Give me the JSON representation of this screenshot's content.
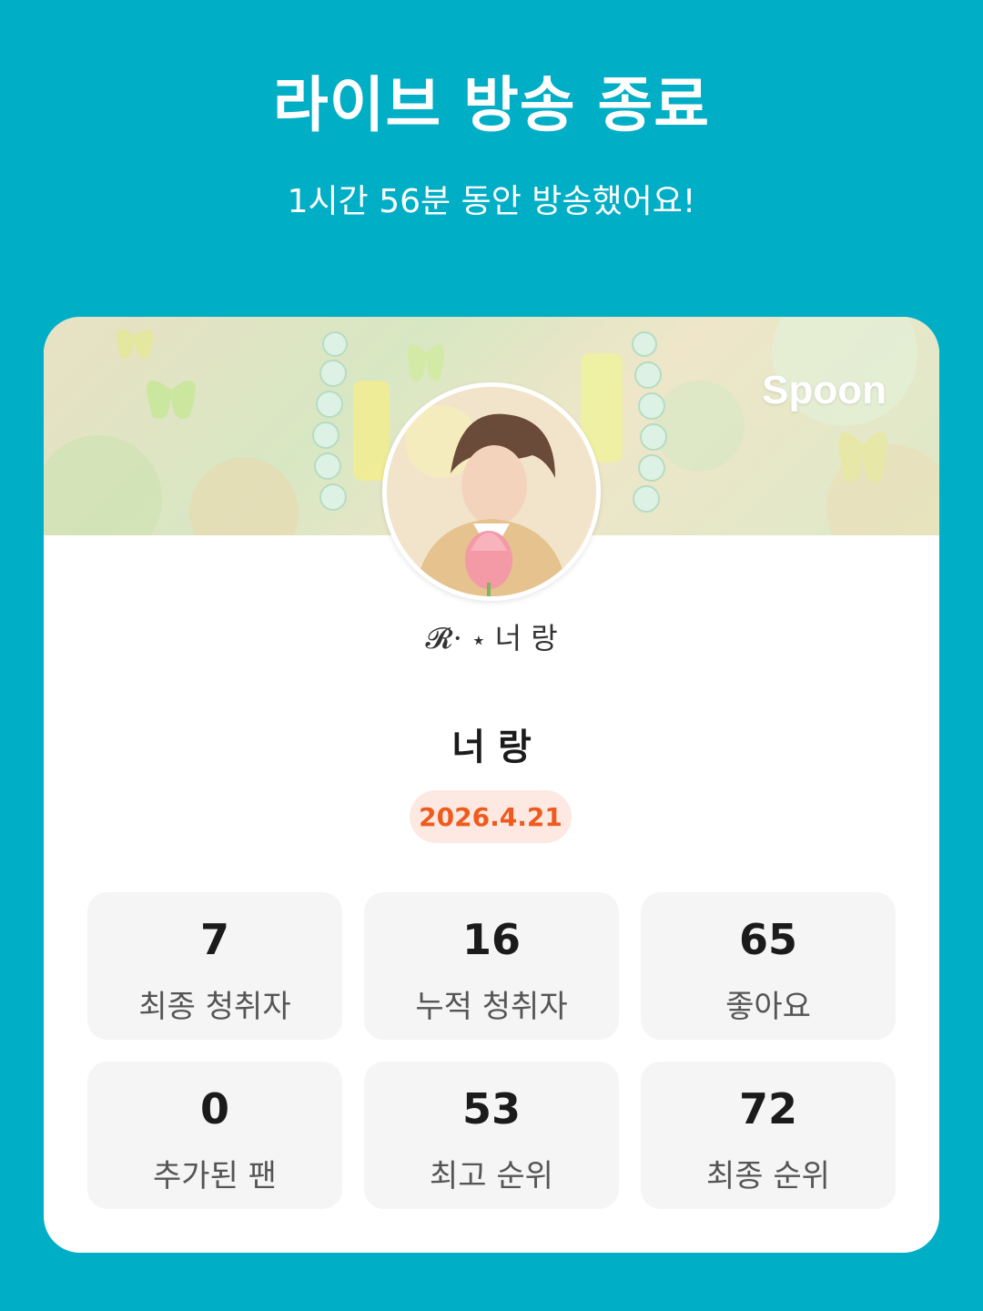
{
  "header": {
    "title": "라이브 방송 종료",
    "subtitle": "1시간 56분 동안 방송했어요!"
  },
  "card": {
    "brand": "Spoon",
    "room_subtitle": "𝓡⋅ ⋆ 너 랑",
    "host_name": "너 랑",
    "date": "2026.4.21"
  },
  "stats": [
    {
      "value": "7",
      "label": "최종 청취자"
    },
    {
      "value": "16",
      "label": "누적 청취자"
    },
    {
      "value": "65",
      "label": "좋아요"
    },
    {
      "value": "0",
      "label": "추가된 팬"
    },
    {
      "value": "53",
      "label": "최고 순위"
    },
    {
      "value": "72",
      "label": "최종 순위"
    }
  ],
  "colors": {
    "background": "#00aec6",
    "card": "#ffffff",
    "tile": "#f5f5f5",
    "date_badge_bg": "#fde8e2",
    "date_text": "#f05a1d"
  }
}
